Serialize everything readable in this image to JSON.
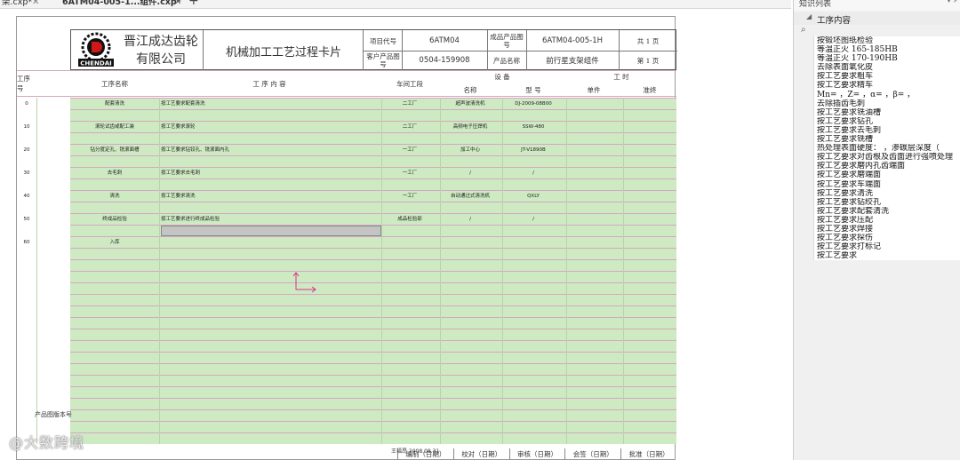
{
  "tabs": [
    {
      "label": "架.cxp*",
      "close": "✕",
      "active": false
    },
    {
      "label": "6ATM04-005-1...组件.cxp*",
      "close": "✕",
      "active": true
    }
  ],
  "tab_add": "+",
  "header": {
    "company_line1": "晋江成达齿轮",
    "company_line2": "有限公司",
    "logo_text": "CHENDAI",
    "card_title": "机械加工工艺过程卡片",
    "project_code_label": "项目代号",
    "project_code_value": "6ATM04",
    "finished_drawing_label": "成品产品图号",
    "finished_drawing_value": "6ATM04-005-1H",
    "total_pages": "共 1 页",
    "customer_drawing_label": "客户产品图号",
    "customer_drawing_value": "0504-159908",
    "product_name_label": "产品名称",
    "product_name_value": "前行星支架组件",
    "page_no": "第 1 页"
  },
  "columns": {
    "op_no": "工序号",
    "op_name": "工序名称",
    "op_content": "工 序 内 容",
    "workshop": "车间工段",
    "equipment": "设 备",
    "eq_name": "名称",
    "eq_model": "型 号",
    "hours": "工 时",
    "single": "单件",
    "prep": "准终"
  },
  "operations": [
    {
      "no": "0",
      "name": "配套清洗",
      "content": "按工艺要求配套清洗",
      "workshop": "二工厂",
      "eq_name": "超声波清洗机",
      "eq_model": "DJ-2009-08B00"
    },
    {
      "no": "10",
      "name": "滚轮试齿或配工装",
      "content": "按工艺要求滚轮",
      "workshop": "二工厂",
      "eq_name": "高频电子压焊机",
      "eq_model": "SSW-480"
    },
    {
      "no": "20",
      "name": "钻分度定孔、铣滚面槽",
      "content": "按工艺要求钻铰孔、铣滚面内孔",
      "workshop": "一工厂",
      "eq_name": "加工中心",
      "eq_model": "JT-V1890B"
    },
    {
      "no": "30",
      "name": "去毛刺",
      "content": "按工艺要求去毛刺",
      "workshop": "一工厂",
      "eq_name": "/",
      "eq_model": "/"
    },
    {
      "no": "40",
      "name": "清洗",
      "content": "按工艺要求清洗",
      "workshop": "一工厂",
      "eq_name": "自动通过式清洗机",
      "eq_model": "QXLY"
    },
    {
      "no": "50",
      "name": "终成品检验",
      "content": "按工艺要求进行终成品检验",
      "workshop": "成品检验部",
      "eq_name": "/",
      "eq_model": "/"
    },
    {
      "no": "60",
      "name": "入库",
      "content": "",
      "workshop": "",
      "eq_name": "",
      "eq_model": ""
    }
  ],
  "left_label": "产品图版本号",
  "footer": {
    "signatures": [
      "编制（日期）",
      "校对（日期）",
      "审核（日期）",
      "会签（日期）",
      "批准（日期）"
    ],
    "date_text": "王福昂  2008.08.31"
  },
  "watermark": "@大数跨境",
  "panel": {
    "title": "知识列表",
    "pin": "▾ ♯",
    "root_label": "工序内容",
    "search_icon": "⌕",
    "items": [
      "按锻坯图纸检验",
      "等温正火 165-185HB",
      "等温正火 170-190HB",
      "去除表面氧化皮",
      "按工艺要求粗车",
      "按工艺要求精车",
      "Mn= ，Z= ，α= ，β= ，",
      "去除插齿毛刺",
      "按工艺要求铣油槽",
      "按工艺要求钻孔",
      "按工艺要求去毛刺",
      "按工艺要求铣槽",
      "热处理表面硬度：  ，渗碳层深度（",
      "按工艺要求对齿根及齿面进行强喷处理",
      "按工艺要求磨内孔齿端面",
      "按工艺要求磨端面",
      "按工艺要求车端面",
      "按工艺要求清洗",
      "按工艺要求钻绞孔",
      "按工艺要求配套清洗",
      "按工艺要求压配",
      "按工艺要求焊接",
      "按工艺要求探伤",
      "按工艺要求打标记",
      "按工艺要求"
    ]
  },
  "colors": {
    "row_fill": "#cdeac2",
    "row_border": "#d8a6c2",
    "selected_cell": "#c4c4c4",
    "arrow": "#e0308c"
  }
}
